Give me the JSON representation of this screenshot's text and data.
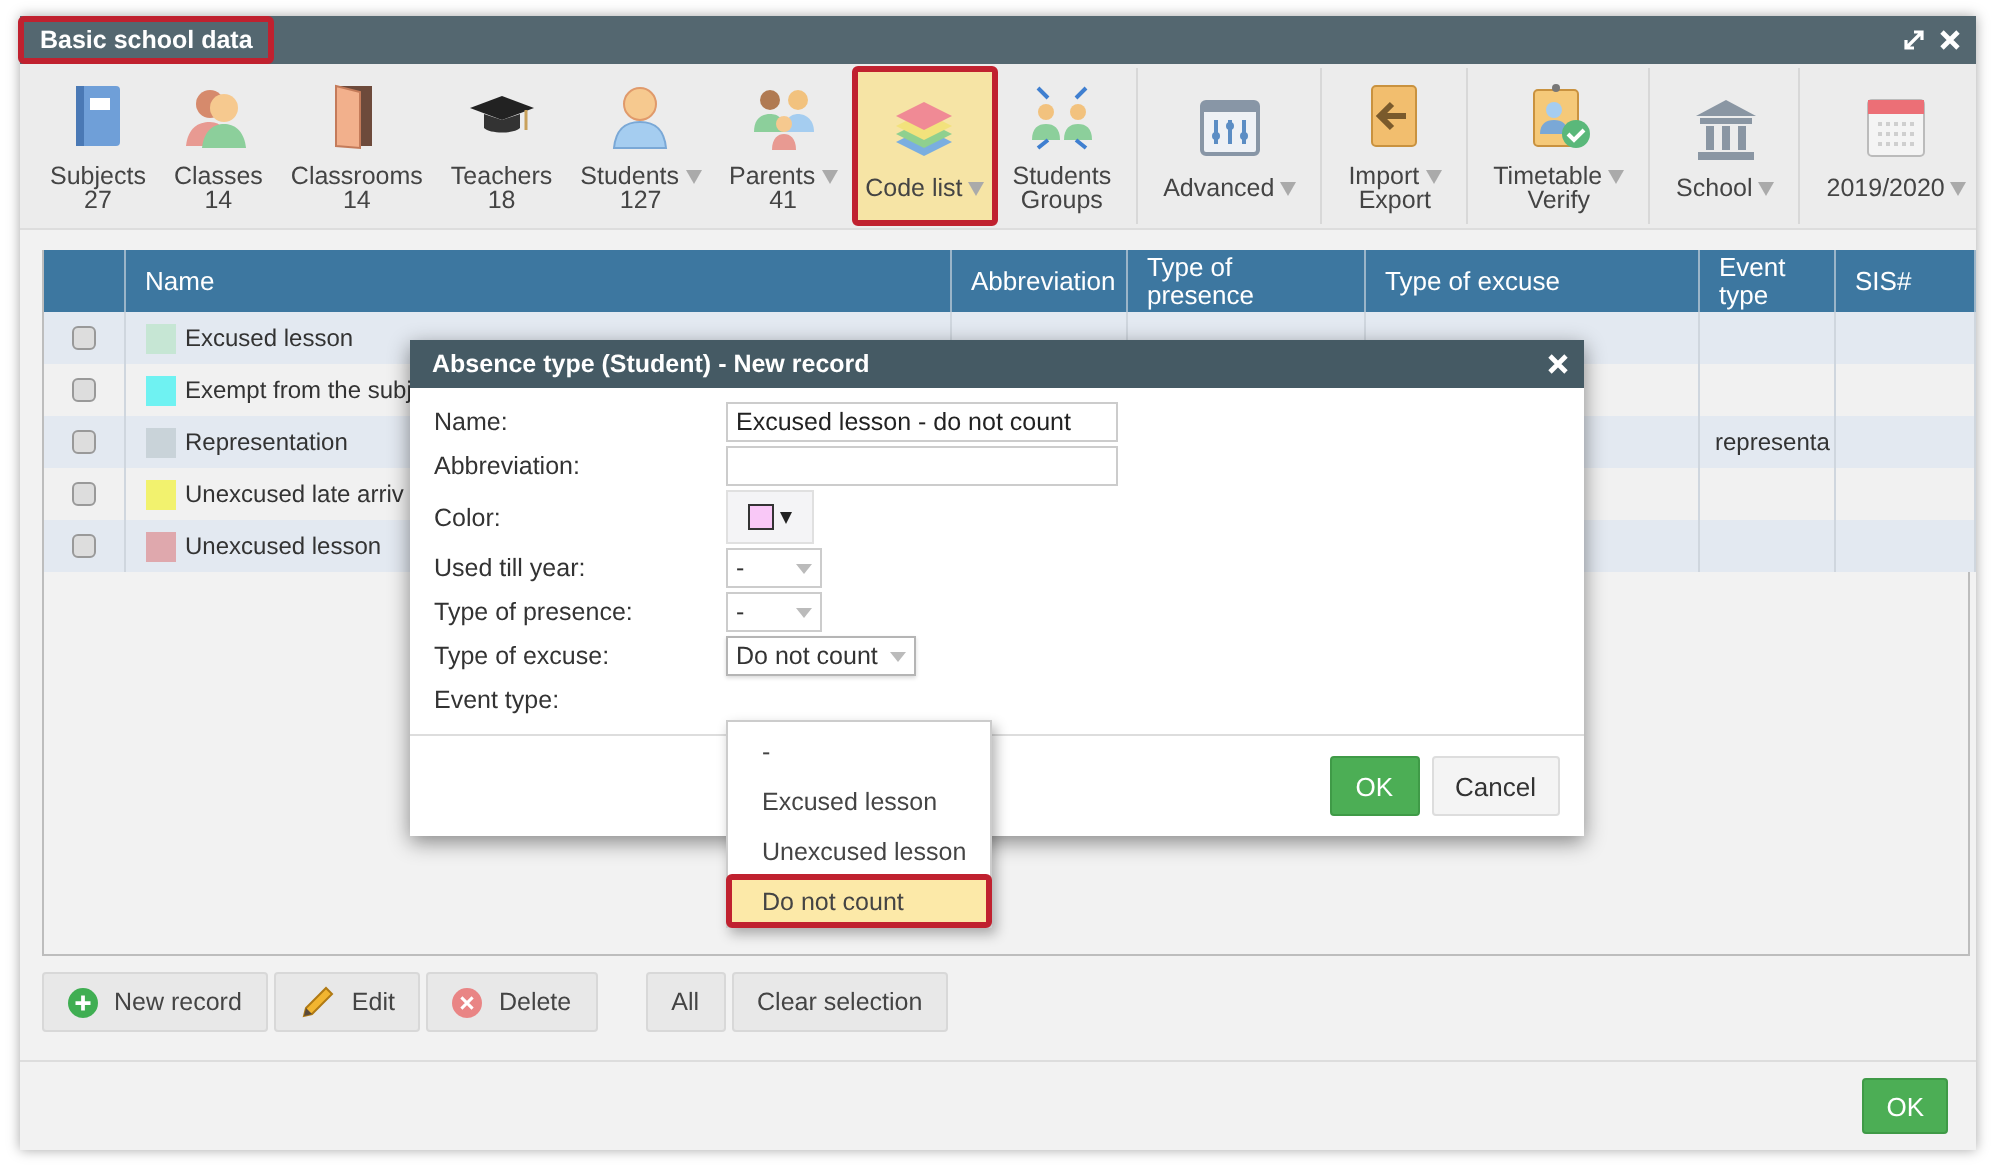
{
  "window": {
    "title": "Basic school data",
    "title_highlighted": true
  },
  "toolbar": [
    {
      "label": "Subjects",
      "count": "27",
      "caret": false,
      "selected": false,
      "highlighted": false,
      "divider": false
    },
    {
      "label": "Classes",
      "count": "14",
      "caret": false,
      "selected": false,
      "highlighted": false,
      "divider": false
    },
    {
      "label": "Classrooms",
      "count": "14",
      "caret": false,
      "selected": false,
      "highlighted": false,
      "divider": false
    },
    {
      "label": "Teachers",
      "count": "18",
      "caret": false,
      "selected": false,
      "highlighted": false,
      "divider": false
    },
    {
      "label": "Students",
      "count": "127",
      "caret": true,
      "selected": false,
      "highlighted": false,
      "divider": false
    },
    {
      "label": "Parents",
      "count": "41",
      "caret": true,
      "selected": false,
      "highlighted": false,
      "divider": false
    },
    {
      "label": "Code list",
      "caret": true,
      "selected": true,
      "highlighted": true,
      "divider": false
    },
    {
      "label": "Students",
      "count": "Groups",
      "caret": false,
      "selected": false,
      "highlighted": false,
      "divider": true
    },
    {
      "label": "Advanced",
      "caret": true,
      "selected": false,
      "highlighted": false,
      "divider": true
    },
    {
      "label": "Import",
      "count": "Export",
      "caret": true,
      "selected": false,
      "highlighted": false,
      "divider": true
    },
    {
      "label": "Timetable",
      "count": "Verify",
      "caret": true,
      "selected": false,
      "highlighted": false,
      "divider": true
    },
    {
      "label": "School",
      "caret": true,
      "selected": false,
      "highlighted": false,
      "divider": true
    },
    {
      "label": "2019/2020",
      "caret": true,
      "selected": false,
      "highlighted": false,
      "divider": false
    }
  ],
  "table": {
    "columns": [
      "Name",
      "Abbreviation",
      "Type of presence",
      "Type of excuse",
      "Event type",
      "SIS#"
    ],
    "rows": [
      {
        "checked": false,
        "color": "#c6e6d4",
        "name": "Excused lesson",
        "event_type": ""
      },
      {
        "checked": false,
        "color": "#6ff2f2",
        "name": "Exempt from the subj",
        "event_type": ""
      },
      {
        "checked": false,
        "color": "#c9d3d9",
        "name": "Representation",
        "event_type": "representa"
      },
      {
        "checked": false,
        "color": "#f2f26e",
        "name": "Unexcused late arriv",
        "event_type": ""
      },
      {
        "checked": false,
        "color": "#dfa8ad",
        "name": "Unexcused lesson",
        "event_type": ""
      }
    ]
  },
  "actions": [
    {
      "label": "New record",
      "kind": "add"
    },
    {
      "label": "Edit",
      "kind": "edit"
    },
    {
      "label": "Delete",
      "kind": "delete"
    },
    {
      "label": "All",
      "kind": "plain"
    },
    {
      "label": "Clear selection",
      "kind": "plain"
    }
  ],
  "ok_button": "OK",
  "dialog": {
    "title": "Absence type (Student) - New record",
    "fields": [
      {
        "label": "Name:",
        "kind": "text",
        "value": "Excused lesson - do not count"
      },
      {
        "label": "Abbreviation:",
        "kind": "text"
      },
      {
        "label": "Color:",
        "kind": "color",
        "color": "#f9c8f7"
      },
      {
        "label": "Used till year:",
        "kind": "select",
        "value": "-",
        "open": false
      },
      {
        "label": "Type of presence:",
        "kind": "select",
        "value": "-",
        "open": false
      },
      {
        "label": "Type of excuse:",
        "kind": "select",
        "value": "Do not count",
        "open": true
      },
      {
        "label": "Event type:",
        "kind": "empty"
      }
    ],
    "options": [
      {
        "label": "-",
        "selected": false,
        "highlighted": false
      },
      {
        "label": "Excused lesson",
        "selected": false,
        "highlighted": false
      },
      {
        "label": "Unexcused lesson",
        "selected": false,
        "highlighted": false
      },
      {
        "label": "Do not count",
        "selected": true,
        "highlighted": true
      }
    ],
    "buttons": [
      {
        "label": "OK",
        "kind": "primary"
      },
      {
        "label": "Cancel",
        "kind": "default"
      }
    ]
  }
}
